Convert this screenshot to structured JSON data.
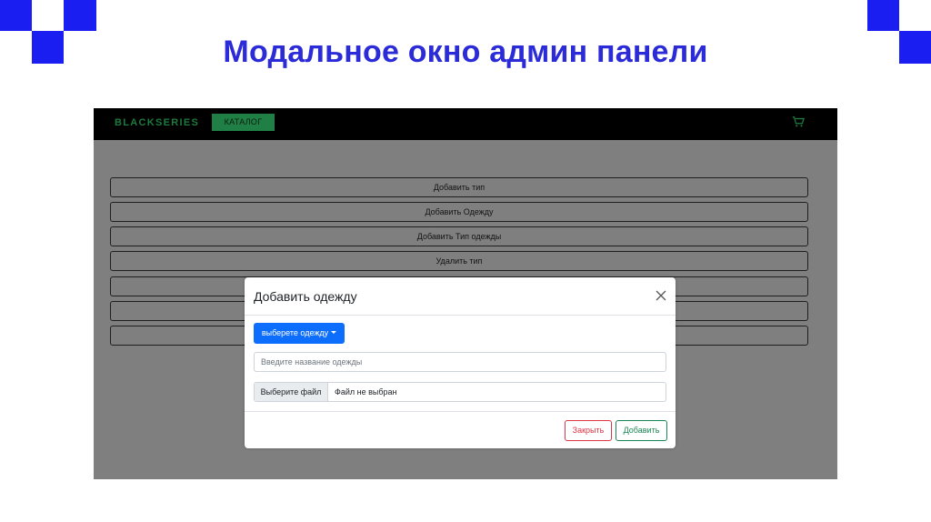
{
  "slide": {
    "title": "Модальное окно админ панели",
    "accent_color": "#1b1ef0"
  },
  "navbar": {
    "brand": "BLACKSERIES",
    "catalog_label": "КАТАЛОГ",
    "cart_icon": "cart-icon"
  },
  "admin_buttons": [
    "Добавить тип",
    "Добавить Одежду",
    "Добавить Тип одежды",
    "Удалить тип",
    "",
    "",
    ""
  ],
  "modal": {
    "title": "Добавить одежду",
    "close_icon": "close-icon",
    "dropdown_label": "выберете одежду",
    "name_placeholder": "Введите название одежды",
    "file_button_label": "Выберите файл",
    "file_status": "Файл не выбран",
    "close_label": "Закрыть",
    "add_label": "Добавить"
  },
  "colors": {
    "primary": "#0d6efd",
    "danger": "#dc3545",
    "success": "#198754",
    "brand_green": "#1f7f45"
  }
}
